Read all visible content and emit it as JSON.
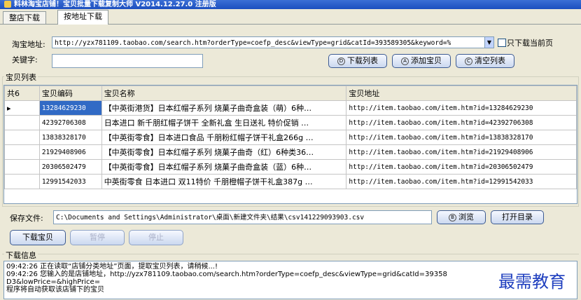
{
  "window": {
    "title": "料林淘宝店铺！宝贝批量下载复制大师 V2014.12.27.0  注册版"
  },
  "tabs": [
    {
      "label": "整店下载"
    },
    {
      "label": "按地址下载"
    }
  ],
  "form": {
    "url_label": "淘宝地址:",
    "url_value": "http://yzx781109.taobao.com/search.htm?orderType=coefp_desc&viewType=grid&catId=393589305&keyword=%",
    "only_current_label": "只下载当前页",
    "keyword_label": "关键字:",
    "keyword_value": ""
  },
  "buttons": {
    "download_list": "下载列表",
    "add_item": "添加宝贝",
    "clear_list": "清空列表",
    "browse": "浏览",
    "open_dir": "打开目录",
    "download_items": "下载宝贝",
    "pause": "暂停",
    "stop": "停止"
  },
  "list": {
    "group_title": "宝贝列表",
    "columns": [
      "共6",
      "宝贝编码",
      "宝贝名称",
      "宝贝地址"
    ],
    "rows": [
      {
        "code": "13284629230",
        "name": "【中英街港货】日本红帽子系列 烧菓子曲奇盒装（萌）6种…",
        "url": "http://item.taobao.com/item.htm?id=13284629230"
      },
      {
        "code": "42392706308",
        "name": "日本进口 新千朋红帽子饼干 全新礼盒 生日送礼 特价促销 …",
        "url": "http://item.taobao.com/item.htm?id=42392706308"
      },
      {
        "code": "13838328170",
        "name": "【中英街零食】日本进口食品 千朋粉红帽子饼干礼盒266g …",
        "url": "http://item.taobao.com/item.htm?id=13838328170"
      },
      {
        "code": "21929408906",
        "name": "【中英街零食】日本红帽子系列 烧菓子曲奇（红）6种类36…",
        "url": "http://item.taobao.com/item.htm?id=21929408906"
      },
      {
        "code": "20306502479",
        "name": "【中英街零食】日本红帽子系列 烧菓子曲奇盒装（蓝）6种…",
        "url": "http://item.taobao.com/item.htm?id=20306502479"
      },
      {
        "code": "12991542033",
        "name": "中英街零食 日本进口 双11特价 千朋橙帽子饼干礼盒387g …",
        "url": "http://item.taobao.com/item.htm?id=12991542033"
      }
    ]
  },
  "save": {
    "label": "保存文件:",
    "path": "C:\\Documents and Settings\\Administrator\\桌面\\新建文件夹\\结果\\csv141229093903.csv"
  },
  "log": {
    "group_title": "下载信息",
    "lines": [
      "09:42:26 正在读取“店铺分类地址”页面，提取宝贝列表，请稍候...!",
      "09:42:26 您输入的是店铺地址，http://yzx781109.taobao.com/search.htm?orderType=coefp_desc&viewType=grid&catId=39358",
      "D3&lowPrice=&highPrice=",
      "程序将自动获取该店铺下的宝贝"
    ]
  },
  "watermark": "最需教育"
}
